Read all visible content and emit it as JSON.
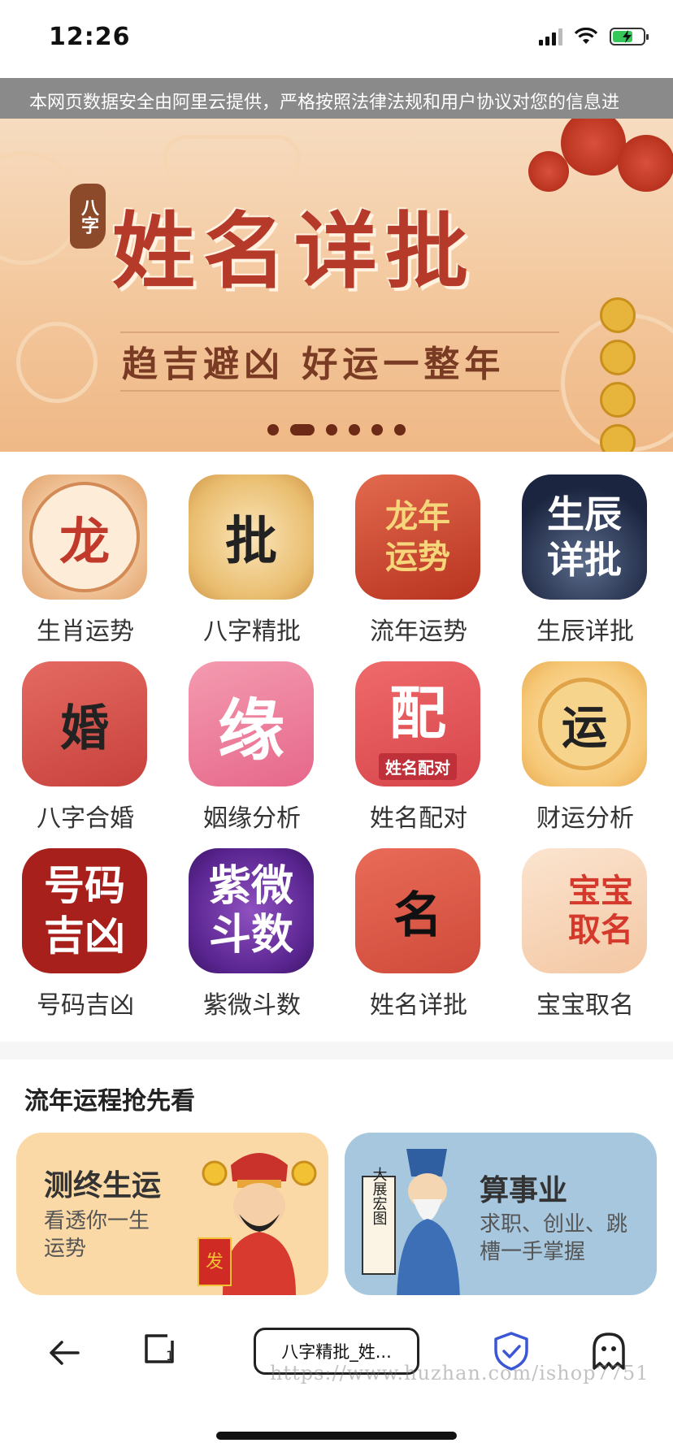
{
  "status": {
    "time": "12:26"
  },
  "notice": {
    "text": "本网页数据安全由阿里云提供，严格按照法律法规和用户协议对您的信息进"
  },
  "banner": {
    "badge": "八字",
    "title": "姓名详批",
    "subtitle": "趋吉避凶  好运一整年",
    "active_slide": 2,
    "slide_count": 6
  },
  "grid": {
    "items": [
      {
        "label": "生肖运势",
        "icon_text": "龙",
        "icon": "zodiac-icon"
      },
      {
        "label": "八字精批",
        "icon_text": "批",
        "icon": "bazi-icon"
      },
      {
        "label": "流年运势",
        "icon_text": "龙年运势",
        "icon": "annual-fortune-icon"
      },
      {
        "label": "生辰详批",
        "icon_text": "生辰详批",
        "icon": "birth-chart-icon"
      },
      {
        "label": "八字合婚",
        "icon_text": "婚",
        "icon": "marriage-icon"
      },
      {
        "label": "姻缘分析",
        "icon_text": "缘",
        "icon": "romance-icon"
      },
      {
        "label": "姓名配对",
        "icon_text": "配",
        "icon_subtext": "姓名配对",
        "icon": "name-match-icon"
      },
      {
        "label": "财运分析",
        "icon_text": "运",
        "icon": "wealth-icon"
      },
      {
        "label": "号码吉凶",
        "icon_text": "号码吉凶",
        "icon": "number-luck-icon"
      },
      {
        "label": "紫微斗数",
        "icon_text": "紫微斗数",
        "icon": "ziwei-icon"
      },
      {
        "label": "姓名详批",
        "icon_text": "名",
        "icon": "name-analysis-icon"
      },
      {
        "label": "宝宝取名",
        "icon_text": "宝宝取名",
        "icon": "baby-naming-icon"
      }
    ]
  },
  "section": {
    "title": "流年运程抢先看",
    "cards": [
      {
        "title": "测终生运",
        "desc": "看透你一生运势",
        "figure_text": "发"
      },
      {
        "title": "算事业",
        "desc": "求职、创业、跳槽一手掌握",
        "figure_text": "大展宏图"
      }
    ]
  },
  "toolbar": {
    "url_label": "八字精批_姓..."
  },
  "watermark": "https://www.huzhan.com/ishop7751",
  "colors": {
    "banner_title": "#b63a2a",
    "shield": "#3b57d6",
    "notice_bg": "#8a8a8a"
  }
}
